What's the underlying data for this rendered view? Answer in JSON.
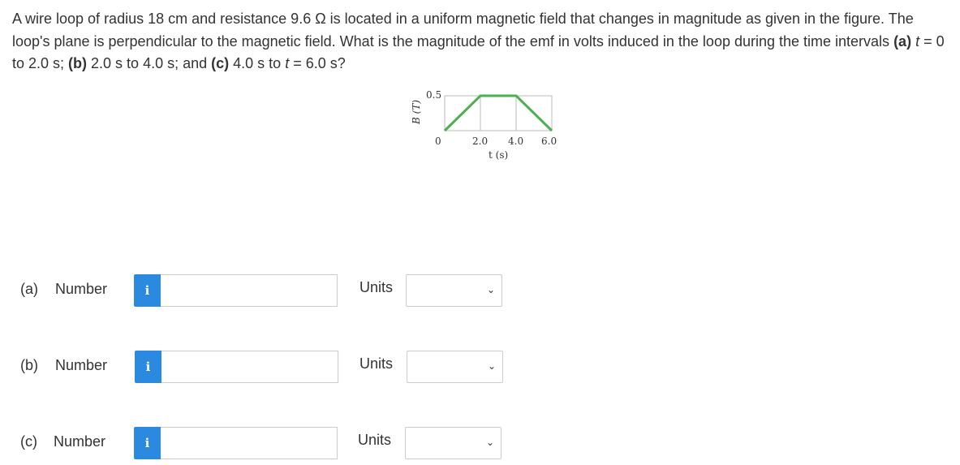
{
  "question": {
    "text_parts": [
      "A wire loop of radius 18 cm and resistance 9.6 Ω is located in a uniform magnetic field that changes in magnitude as given in the figure. The loop's plane is perpendicular to the magnetic field. What is the magnitude of the emf in volts induced in the loop during the time intervals ",
      "(a)",
      " ",
      "t",
      " = 0 to 2.0 s; ",
      "(b)",
      " 2.0 s to 4.0 s; and ",
      "(c)",
      " 4.0 s to ",
      "t",
      " = 6.0 s?"
    ]
  },
  "figure": {
    "ylabel": "B (T)",
    "xlabel": "t (s)",
    "yticks": [
      "0.5"
    ],
    "xticks": [
      "0",
      "2.0",
      "4.0",
      "6.0"
    ],
    "points": [
      [
        0,
        0
      ],
      [
        2.0,
        0.5
      ],
      [
        4.0,
        0.5
      ],
      [
        6.0,
        0
      ]
    ],
    "xlim": [
      0,
      6.0
    ],
    "ylim": [
      0,
      0.5
    ],
    "line_color": "#4caf50"
  },
  "rows": [
    {
      "part": "(a)",
      "label": "Number",
      "info": "i",
      "units_label": "Units",
      "value": "",
      "unit": ""
    },
    {
      "part": "(b)",
      "label": "Number",
      "info": "i",
      "units_label": "Units",
      "value": "",
      "unit": ""
    },
    {
      "part": "(c)",
      "label": "Number",
      "info": "i",
      "units_label": "Units",
      "value": "",
      "unit": ""
    }
  ],
  "colors": {
    "info_button": "#2b8ae0"
  }
}
